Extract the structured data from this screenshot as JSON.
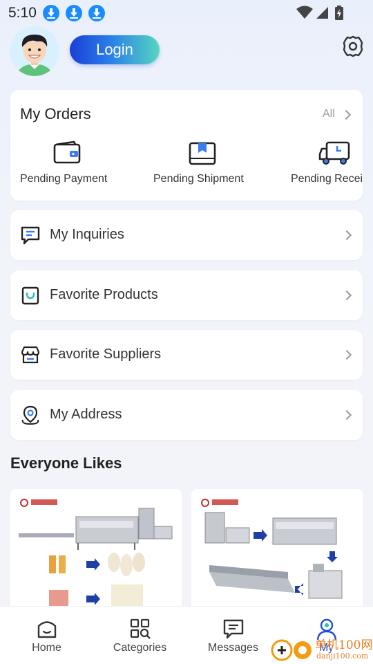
{
  "status_bar": {
    "time": "5:10"
  },
  "header": {
    "login_label": "Login"
  },
  "orders": {
    "title": "My Orders",
    "all_label": "All",
    "items": [
      {
        "label": "Pending Payment",
        "icon": "wallet-icon"
      },
      {
        "label": "Pending Shipment",
        "icon": "package-icon"
      },
      {
        "label": "Pending Receipt",
        "icon": "truck-icon"
      }
    ]
  },
  "menu": [
    {
      "label": "My Inquiries",
      "icon": "message-icon"
    },
    {
      "label": "Favorite Products",
      "icon": "bag-icon"
    },
    {
      "label": "Favorite Suppliers",
      "icon": "store-icon"
    },
    {
      "label": "My Address",
      "icon": "location-icon"
    }
  ],
  "everyone_likes": {
    "title": "Everyone Likes"
  },
  "bottom_nav": [
    {
      "label": "Home",
      "icon": "home-icon"
    },
    {
      "label": "Categories",
      "icon": "categories-icon"
    },
    {
      "label": "Messages",
      "icon": "messages-icon"
    },
    {
      "label": "My",
      "icon": "user-icon",
      "active": true
    }
  ],
  "colors": {
    "accent": "#1f4fd9",
    "login_gradient_start": "#1a3fd6",
    "login_gradient_end": "#55d6c0",
    "download_badge": "#1a8cff"
  },
  "watermark": {
    "line1": "单机100网",
    "line2": "danji100.com"
  }
}
